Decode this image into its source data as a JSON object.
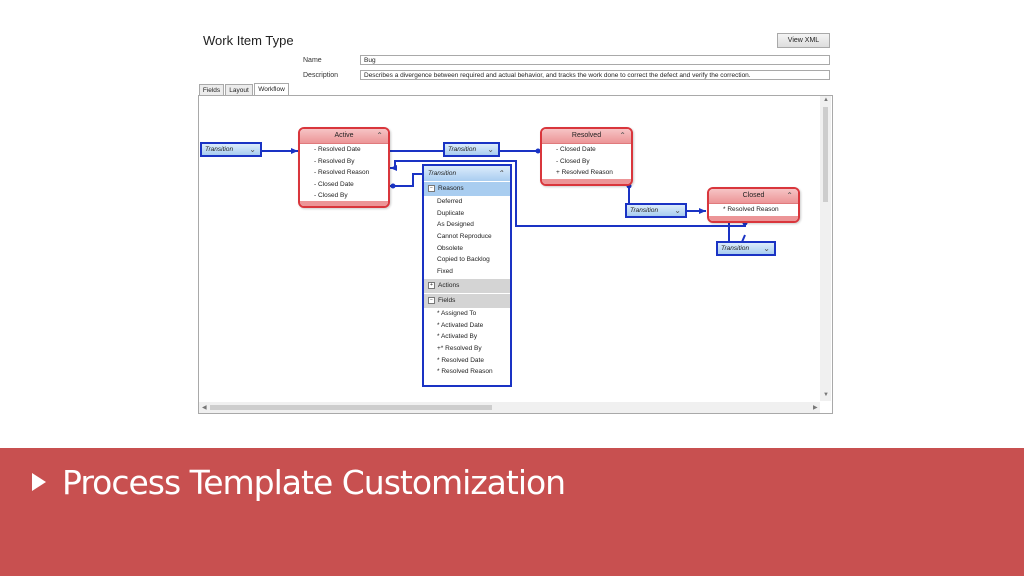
{
  "window": {
    "title": "Work Item Type",
    "view_xml_label": "View XML"
  },
  "form": {
    "name_label": "Name",
    "name_value": "Bug",
    "description_label": "Description",
    "description_value": "Describes a divergence between required and actual behavior, and tracks the work done to correct the defect and verify the correction."
  },
  "tabs": [
    {
      "label": "Fields",
      "active": false
    },
    {
      "label": "Layout",
      "active": false
    },
    {
      "label": "Workflow",
      "active": true
    }
  ],
  "workflow": {
    "states": [
      {
        "name": "Active",
        "items": [
          "- Resolved Date",
          "- Resolved By",
          "- Resolved Reason",
          "- Closed Date",
          "- Closed By"
        ]
      },
      {
        "name": "Resolved",
        "items": [
          "- Closed Date",
          "- Closed By",
          "+ Resolved Reason"
        ]
      },
      {
        "name": "Closed",
        "items": [
          "* Resolved Reason"
        ]
      }
    ],
    "transition_label": "Transition",
    "transition_detail": {
      "title": "Transition",
      "reasons_label": "Reasons",
      "reasons": [
        "Deferred",
        "Duplicate",
        "As Designed",
        "Cannot Reproduce",
        "Obsolete",
        "Copied to Backlog",
        "Fixed"
      ],
      "actions_label": "Actions",
      "fields_label": "Fields",
      "fields": [
        "* Assigned To",
        "* Activated Date",
        "* Activated By",
        "+* Resolved By",
        "* Resolved Date",
        "* Resolved Reason"
      ]
    }
  },
  "icons": {
    "collapse": "double-chevron-up-icon",
    "expand": "double-chevron-down-icon",
    "collapse_section": "minus-box-icon",
    "expand_section": "plus-box-icon"
  },
  "colors": {
    "state_border": "#d9363c",
    "transition_border": "#1a33c4",
    "banner": "#c85050"
  },
  "banner": {
    "title": "Process Template Customization"
  }
}
